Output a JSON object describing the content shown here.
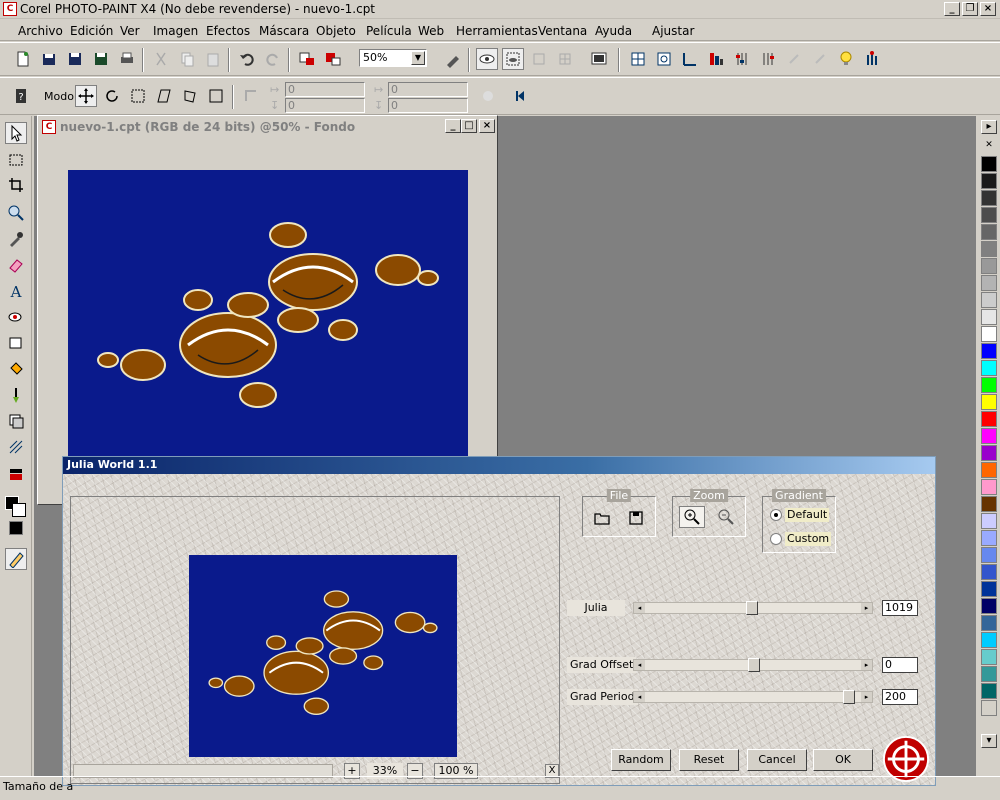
{
  "app": {
    "title": "Corel PHOTO-PAINT X4 (No debe revenderse) - nuevo-1.cpt"
  },
  "window_controls": {
    "minimize": "_",
    "restore": "❐",
    "close": "×"
  },
  "menu": [
    "Archivo",
    "Edición",
    "Ver",
    "Imagen",
    "Efectos",
    "Máscara",
    "Objeto",
    "Película",
    "Web",
    "Herramientas",
    "Ventana",
    "Ayuda",
    "Ajustar"
  ],
  "toolbar": {
    "zoom_value": "50%"
  },
  "property_bar": {
    "mode_label": "Modo",
    "x1": "0",
    "y1": "0",
    "x2": "0",
    "y2": "0"
  },
  "document": {
    "title": "nuevo-1.cpt (RGB de 24 bits) @50% - Fondo",
    "background": "#0a1a8c"
  },
  "dialog": {
    "title": "Julia World 1.1",
    "file_group": "File",
    "zoom_group": "Zoom",
    "gradient_group": "Gradient",
    "gradient_options": [
      "Default",
      "Custom"
    ],
    "gradient_selected": "Default",
    "sliders": [
      {
        "label": "Julia",
        "value": "1019",
        "level": 0.49
      },
      {
        "label": "Grad Offset",
        "value": "0",
        "level": 0.5
      },
      {
        "label": "Grad Period",
        "value": "200",
        "level": 0.96
      }
    ],
    "zoom_plus": "+",
    "zoom_level": "33%",
    "zoom_minus": "−",
    "zoom_100": "100 %",
    "close_x": "X",
    "buttons": {
      "random": "Random",
      "reset": "Reset",
      "cancel": "Cancel",
      "ok": "OK"
    }
  },
  "palette_colors": [
    "#000000",
    "#1a1a1a",
    "#333333",
    "#4d4d4d",
    "#666666",
    "#808080",
    "#999999",
    "#b3b3b3",
    "#cccccc",
    "#e6e6e6",
    "#ffffff",
    "#0000ff",
    "#00ffff",
    "#00ff00",
    "#ffff00",
    "#ff0000",
    "#ff00ff",
    "#9900cc",
    "#ff6600",
    "#ff99cc",
    "#663300",
    "#ccccff",
    "#99aaff",
    "#6688ee",
    "#3355cc",
    "#003399",
    "#000066",
    "#336699",
    "#00ccff",
    "#66cccc",
    "#339999",
    "#006666",
    "#d4d0c8"
  ],
  "status": {
    "text": "Tamaño de a"
  }
}
